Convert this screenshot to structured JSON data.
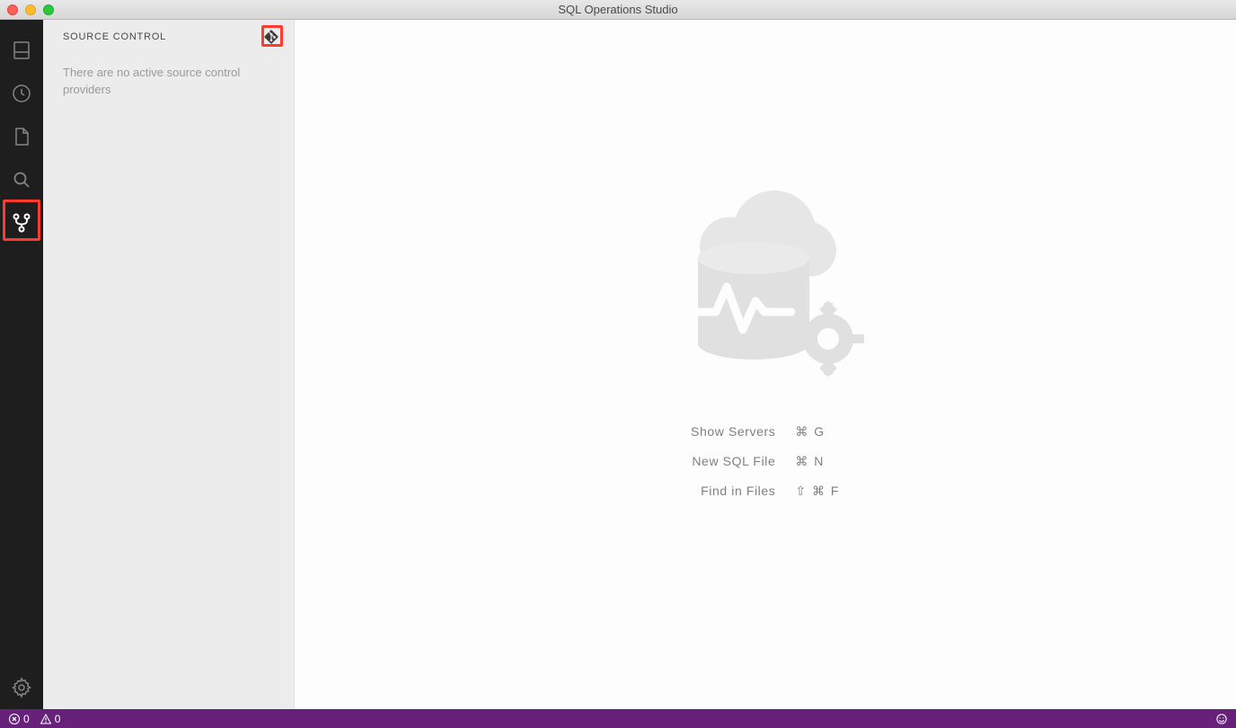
{
  "titlebar": {
    "title": "SQL Operations Studio"
  },
  "activity": {
    "icons": [
      "servers-icon",
      "clock-icon",
      "file-icon",
      "search-icon",
      "source-control-icon"
    ],
    "settings_icon": "gear-icon"
  },
  "sidebar": {
    "title": "SOURCE CONTROL",
    "git_action_icon": "git-icon",
    "empty_message": "There are no active source control providers"
  },
  "welcome": {
    "shortcuts": [
      {
        "label": "Show Servers",
        "keys": "⌘ G"
      },
      {
        "label": "New SQL File",
        "keys": "⌘ N"
      },
      {
        "label": "Find in Files",
        "keys": "⇧ ⌘ F"
      }
    ]
  },
  "statusbar": {
    "errors": "0",
    "warnings": "0",
    "feedback_icon": "smiley-icon"
  }
}
